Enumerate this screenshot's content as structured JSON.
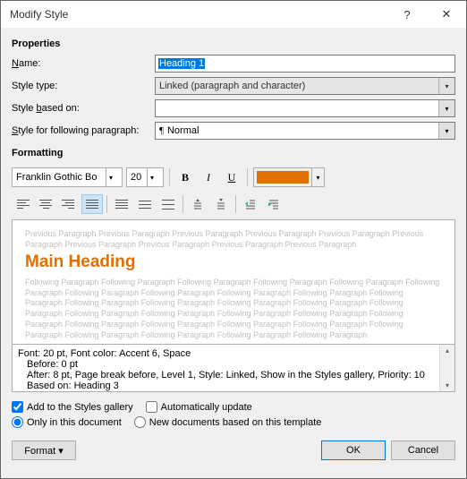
{
  "titlebar": {
    "title": "Modify Style"
  },
  "sections": {
    "properties": "Properties",
    "formatting": "Formatting"
  },
  "labels": {
    "name": "Name:",
    "style_type": "Style type:",
    "based_on": "Style based on:",
    "following": "Style for following paragraph:"
  },
  "values": {
    "name": "Heading 1",
    "style_type": "Linked (paragraph and character)",
    "based_on": "",
    "following": "Normal"
  },
  "font": {
    "family": "Franklin Gothic Bo",
    "size": "20",
    "bold": "B",
    "italic": "I",
    "underline": "U"
  },
  "color": {
    "accent": "#e07000"
  },
  "preview": {
    "prev_text": "Previous Paragraph Previous Paragraph Previous Paragraph Previous Paragraph Previous Paragraph Previous Paragraph Previous Paragraph Previous Paragraph Previous Paragraph Previous Paragraph",
    "heading": "Main Heading",
    "follow_text": "Following Paragraph Following Paragraph Following Paragraph Following Paragraph Following Paragraph Following Paragraph Following Paragraph Following Paragraph Following Paragraph Following Paragraph Following Paragraph Following Paragraph Following Paragraph Following Paragraph Following Paragraph Following Paragraph Following Paragraph Following Paragraph Following Paragraph Following Paragraph Following Paragraph Following Paragraph Following Paragraph Following Paragraph Following Paragraph Following Paragraph Following Paragraph Following Paragraph Following Paragraph Following Paragraph"
  },
  "description": {
    "line1": "Font: 20 pt, Font color: Accent 6, Space",
    "line2": "Before:  0 pt",
    "line3": "After:  8 pt, Page break before, Level 1, Style: Linked, Show in the Styles gallery, Priority: 10",
    "line4": "Based on: Heading 3"
  },
  "options": {
    "add_to_gallery": "Add to the Styles gallery",
    "auto_update": "Automatically update",
    "only_doc": "Only in this document",
    "new_docs": "New documents based on this template"
  },
  "buttons": {
    "format": "Format",
    "ok": "OK",
    "cancel": "Cancel"
  }
}
